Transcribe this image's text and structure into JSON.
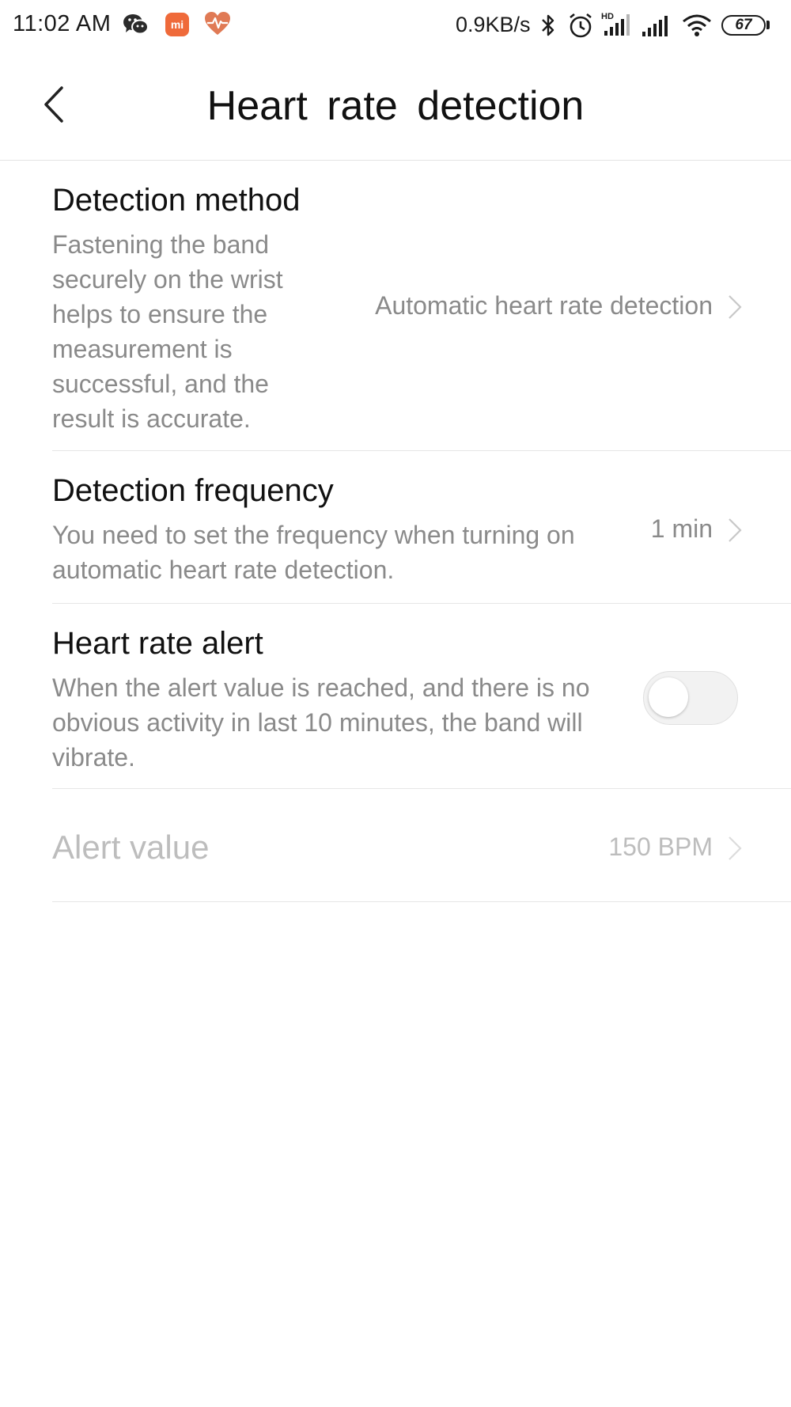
{
  "status_bar": {
    "time": "11:02 AM",
    "notification_icons": [
      "wechat-icon",
      "mi-icon",
      "health-icon"
    ],
    "mi_label": "mi",
    "net_speed": "0.9KB/s",
    "system_icons": [
      "bluetooth-icon",
      "alarm-icon",
      "hd-signal-icon",
      "signal-icon",
      "wifi-icon"
    ],
    "battery_level": "67"
  },
  "header": {
    "title": "Heart rate detection",
    "back_icon": "chevron-left-icon"
  },
  "settings": {
    "detection_method": {
      "title": "Detection method",
      "description": "Fastening the band securely on the wrist helps to ensure the measurement is successful, and the result is accurate.",
      "value": "Automatic heart rate detection"
    },
    "detection_frequency": {
      "title": "Detection frequency",
      "description": "You need to set the frequency when turning on automatic heart rate detection.",
      "value": "1 min"
    },
    "heart_rate_alert": {
      "title": "Heart rate alert",
      "description": "When the alert value is reached, and there is no obvious activity in last 10 minutes, the band will vibrate.",
      "enabled": false
    },
    "alert_value": {
      "title": "Alert value",
      "value": "150 BPM",
      "disabled": true
    }
  },
  "colors": {
    "mi_badge": "#ef6a3a",
    "health_icon": "#e07a55",
    "secondary_text": "#8a8a8a",
    "disabled_text": "#bdbdbd",
    "divider": "#e6e6e6"
  }
}
